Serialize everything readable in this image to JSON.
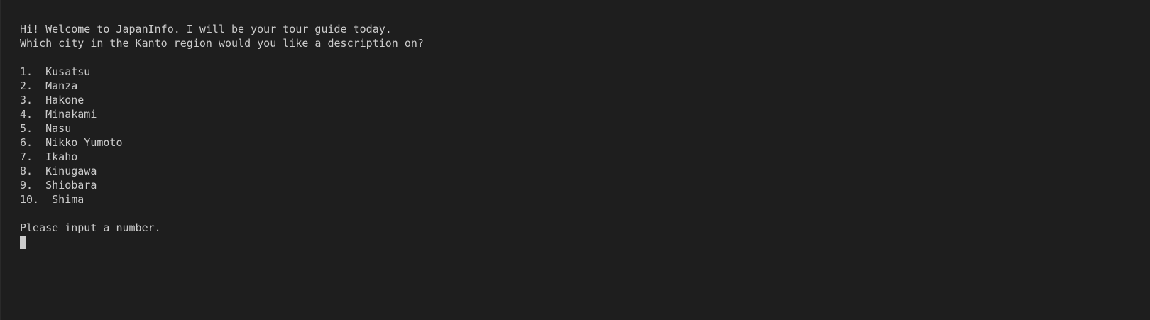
{
  "greeting": "Hi! Welcome to JapanInfo. I will be your tour guide today.",
  "question": "Which city in the Kanto region would you like a description on?",
  "cities": [
    {
      "number": "1.",
      "sep": "  ",
      "name": "Kusatsu"
    },
    {
      "number": "2.",
      "sep": "  ",
      "name": "Manza"
    },
    {
      "number": "3.",
      "sep": "  ",
      "name": "Hakone"
    },
    {
      "number": "4.",
      "sep": "  ",
      "name": "Minakami"
    },
    {
      "number": "5.",
      "sep": "  ",
      "name": "Nasu"
    },
    {
      "number": "6.",
      "sep": "  ",
      "name": "Nikko Yumoto"
    },
    {
      "number": "7.",
      "sep": "  ",
      "name": "Ikaho"
    },
    {
      "number": "8.",
      "sep": "  ",
      "name": "Kinugawa"
    },
    {
      "number": "9.",
      "sep": "  ",
      "name": "Shiobara"
    },
    {
      "number": "10.",
      "sep": "  ",
      "name": "Shima"
    }
  ],
  "prompt": "Please input a number.",
  "colors": {
    "background": "#1e1e1e",
    "text": "#cccccc",
    "cursor": "#cccccc"
  }
}
